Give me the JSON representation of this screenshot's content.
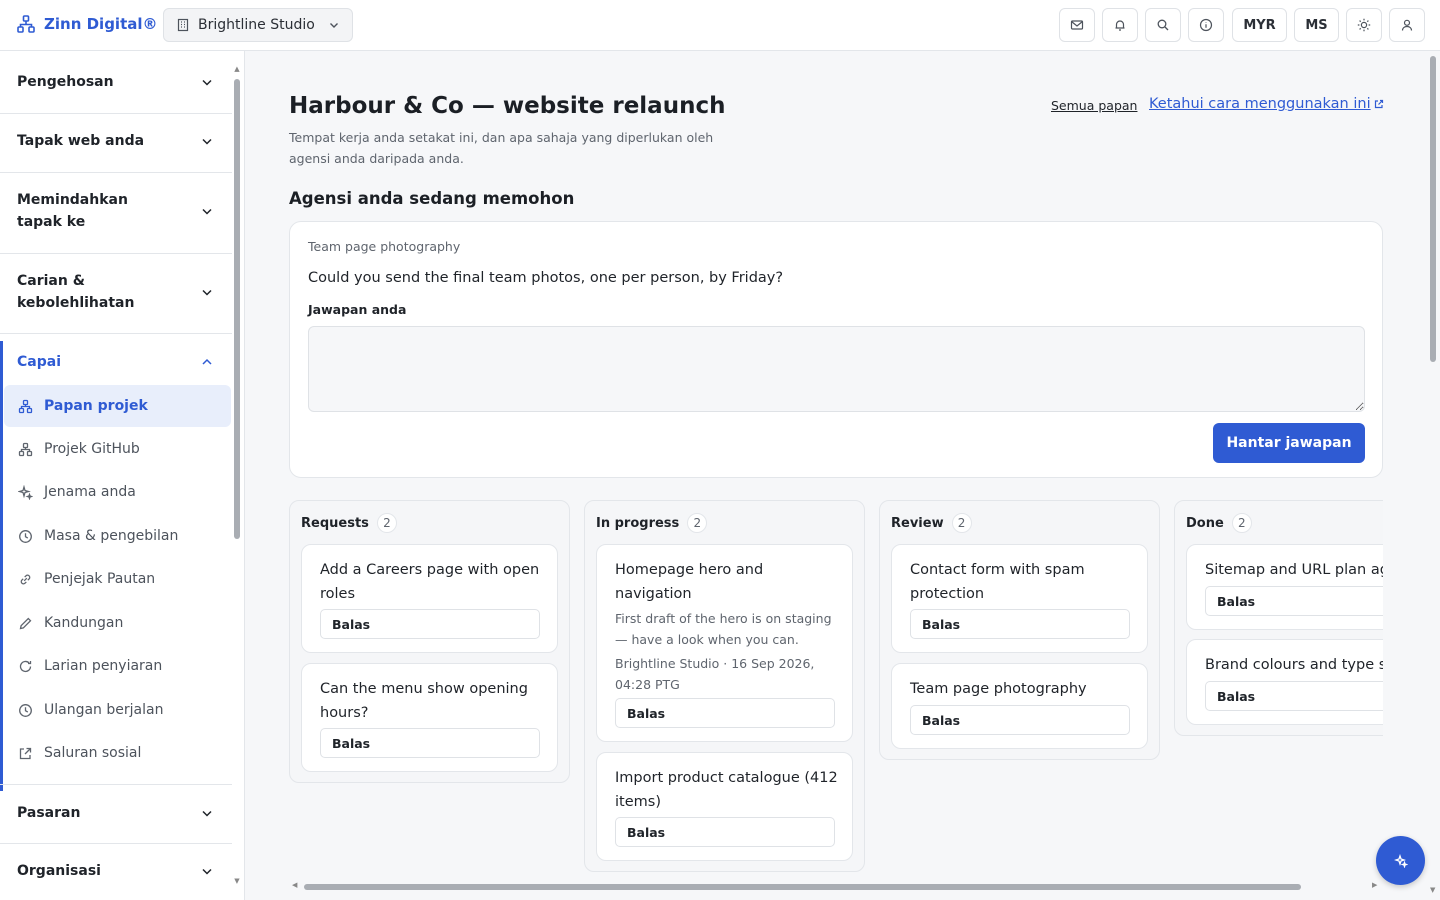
{
  "brand": {
    "name": "Zinn Digital®"
  },
  "workspace": {
    "name": "Brightline Studio"
  },
  "topbar": {
    "currency": "MYR",
    "language": "MS"
  },
  "sidebar": {
    "sections": [
      {
        "label": "Pengehosan"
      },
      {
        "label": "Tapak web anda"
      },
      {
        "label": "Memindahkan tapak ke"
      },
      {
        "label": "Carian & kebolehlihatan"
      },
      {
        "label": "Capai"
      },
      {
        "label": "Pasaran"
      },
      {
        "label": "Organisasi"
      }
    ],
    "items": [
      {
        "label": "Papan projek",
        "icon": "board-icon"
      },
      {
        "label": "Projek GitHub",
        "icon": "github-icon"
      },
      {
        "label": "Jenama anda",
        "icon": "sparkle-icon"
      },
      {
        "label": "Masa & pengebilan",
        "icon": "clock-icon"
      },
      {
        "label": "Penjejak Pautan",
        "icon": "link-icon"
      },
      {
        "label": "Kandungan",
        "icon": "pencil-icon"
      },
      {
        "label": "Larian penyiaran",
        "icon": "refresh-icon"
      },
      {
        "label": "Ulangan berjalan",
        "icon": "clock-icon"
      },
      {
        "label": "Saluran sosial",
        "icon": "external-link-icon"
      }
    ]
  },
  "page": {
    "title": "Harbour & Co — website relaunch",
    "description": "Tempat kerja anda setakat ini, dan apa sahaja yang diperlukan oleh agensi anda daripada anda.",
    "all_boards": "Semua papan",
    "learn": "Ketahui cara menggunakan ini"
  },
  "request": {
    "heading": "Agensi anda sedang memohon",
    "topic": "Team page photography",
    "question": "Could you send the final team photos, one per person, by Friday?",
    "answer_label": "Jawapan anda",
    "answer_value": "",
    "send_label": "Hantar jawapan"
  },
  "board": {
    "reply_label": "Balas",
    "columns": [
      {
        "name": "Requests",
        "count": "2",
        "tasks": [
          {
            "title": "Add a Careers page with open roles"
          },
          {
            "title": "Can the menu show opening hours?"
          }
        ]
      },
      {
        "name": "In progress",
        "count": "2",
        "tasks": [
          {
            "title": "Homepage hero and navigation",
            "note": "First draft of the hero is on staging — have a look when you can.",
            "meta": "Brightline Studio · 16 Sep 2026, 04:28 PTG"
          },
          {
            "title": "Import product catalogue (412 items)"
          }
        ]
      },
      {
        "name": "Review",
        "count": "2",
        "tasks": [
          {
            "title": "Contact form with spam protection"
          },
          {
            "title": "Team page photography"
          }
        ]
      },
      {
        "name": "Done",
        "count": "2",
        "tasks": [
          {
            "title": "Sitemap and URL plan agreed"
          },
          {
            "title": "Brand colours and type set"
          }
        ]
      }
    ]
  },
  "colors": {
    "accent": "#2f5bd3",
    "selected_bg": "#e8eefb"
  }
}
